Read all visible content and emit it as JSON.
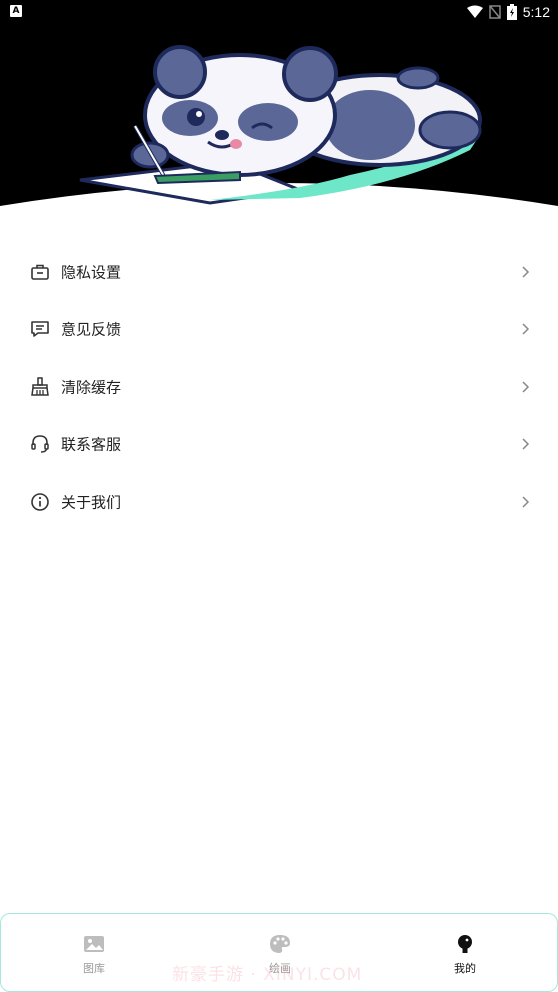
{
  "status_bar": {
    "time": "5:12",
    "left_badge": "A"
  },
  "menu": {
    "items": [
      {
        "label": "隐私设置",
        "icon": "briefcase-icon"
      },
      {
        "label": "意见反馈",
        "icon": "message-square-icon"
      },
      {
        "label": "清除缓存",
        "icon": "broom-icon"
      },
      {
        "label": "联系客服",
        "icon": "headset-icon"
      },
      {
        "label": "关于我们",
        "icon": "info-circle-icon"
      }
    ]
  },
  "bottom_nav": {
    "tabs": [
      {
        "label": "图库",
        "icon": "image-icon",
        "active": false
      },
      {
        "label": "绘画",
        "icon": "palette-icon",
        "active": false
      },
      {
        "label": "我的",
        "icon": "user-icon",
        "active": true
      }
    ]
  },
  "watermark": "新豪手游 · XINYI.COM",
  "colors": {
    "header_bg": "#000000",
    "accent": "#6ee7c8",
    "active_tab": "#111111",
    "inactive_tab": "#999999"
  }
}
